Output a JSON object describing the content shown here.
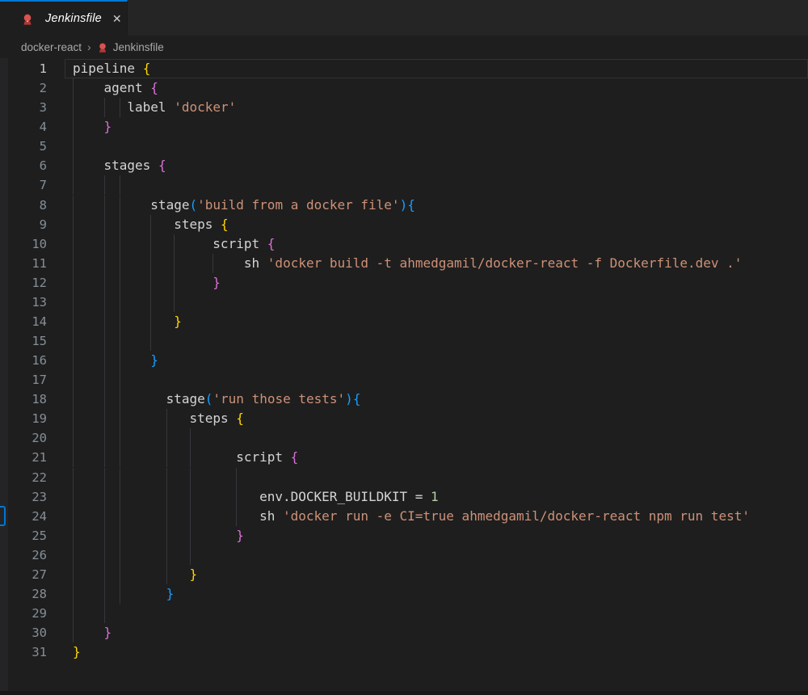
{
  "colors": {
    "bg": "#1e1e1e",
    "panel": "#252526",
    "accent": "#0078d4",
    "crumb": "#a9a9a9",
    "fg": "#d4d4d4",
    "str": "#ce9178",
    "b1": "#ffd700",
    "b2": "#da70d6",
    "b3": "#179fff",
    "num": "#b5cea8",
    "lineNo": "#858f98",
    "lineNoActive": "#c8c8c8",
    "guide": "#37373c",
    "curBorder": "#323232",
    "jenkinsRed": "#d9534f",
    "jenkinsDark": "#7f2a28"
  },
  "tab": {
    "title": "Jenkinsfile",
    "close_label": "✕"
  },
  "breadcrumb": {
    "items": [
      "docker-react",
      "Jenkinsfile"
    ],
    "separator": "›"
  },
  "editor": {
    "current_line": 1,
    "decoration_line": 24,
    "lines": [
      {
        "n": 1,
        "indent": 0,
        "guides": [],
        "spans": [
          [
            "pipeline ",
            "fg"
          ],
          [
            "{",
            "b1"
          ]
        ]
      },
      {
        "n": 2,
        "indent": 4,
        "guides": [
          0
        ],
        "spans": [
          [
            "agent ",
            "fg"
          ],
          [
            "{",
            "b2"
          ]
        ]
      },
      {
        "n": 3,
        "indent": 7,
        "guides": [
          0,
          4,
          6
        ],
        "spans": [
          [
            "label ",
            "fg"
          ],
          [
            "'docker'",
            "str"
          ]
        ]
      },
      {
        "n": 4,
        "indent": 4,
        "guides": [
          0
        ],
        "spans": [
          [
            "}",
            "b2"
          ]
        ]
      },
      {
        "n": 5,
        "indent": 0,
        "guides": [
          0
        ],
        "spans": []
      },
      {
        "n": 6,
        "indent": 4,
        "guides": [
          0
        ],
        "spans": [
          [
            "stages ",
            "fg"
          ],
          [
            "{",
            "b2"
          ]
        ]
      },
      {
        "n": 7,
        "indent": 0,
        "guides": [
          0,
          4,
          6
        ],
        "spans": []
      },
      {
        "n": 8,
        "indent": 10,
        "guides": [
          0,
          4,
          6
        ],
        "spans": [
          [
            "stage",
            "fg"
          ],
          [
            "(",
            "b3"
          ],
          [
            "'build from a docker file'",
            "str"
          ],
          [
            ")",
            "b3"
          ],
          [
            "{",
            "b3"
          ]
        ]
      },
      {
        "n": 9,
        "indent": 13,
        "guides": [
          0,
          4,
          6,
          10
        ],
        "spans": [
          [
            "steps ",
            "fg"
          ],
          [
            "{",
            "b1"
          ]
        ]
      },
      {
        "n": 10,
        "indent": 18,
        "guides": [
          0,
          4,
          6,
          10,
          13
        ],
        "spans": [
          [
            "script ",
            "fg"
          ],
          [
            "{",
            "b2"
          ]
        ]
      },
      {
        "n": 11,
        "indent": 22,
        "guides": [
          0,
          4,
          6,
          10,
          13,
          18
        ],
        "spans": [
          [
            "sh ",
            "fg"
          ],
          [
            "'docker build -t ahmedgamil/docker-react -f Dockerfile.dev .'",
            "str"
          ]
        ]
      },
      {
        "n": 12,
        "indent": 18,
        "guides": [
          0,
          4,
          6,
          10,
          13
        ],
        "spans": [
          [
            "}",
            "b2"
          ]
        ]
      },
      {
        "n": 13,
        "indent": 0,
        "guides": [
          0,
          4,
          6,
          10,
          13
        ],
        "spans": []
      },
      {
        "n": 14,
        "indent": 13,
        "guides": [
          0,
          4,
          6,
          10
        ],
        "spans": [
          [
            "}",
            "b1"
          ]
        ]
      },
      {
        "n": 15,
        "indent": 0,
        "guides": [
          0,
          4,
          6,
          10
        ],
        "spans": []
      },
      {
        "n": 16,
        "indent": 10,
        "guides": [
          0,
          4,
          6
        ],
        "spans": [
          [
            "}",
            "b3"
          ]
        ]
      },
      {
        "n": 17,
        "indent": 0,
        "guides": [
          0,
          4,
          6
        ],
        "spans": []
      },
      {
        "n": 18,
        "indent": 12,
        "guides": [
          0,
          4,
          6
        ],
        "spans": [
          [
            "stage",
            "fg"
          ],
          [
            "(",
            "b3"
          ],
          [
            "'run those tests'",
            "str"
          ],
          [
            ")",
            "b3"
          ],
          [
            "{",
            "b3"
          ]
        ]
      },
      {
        "n": 19,
        "indent": 15,
        "guides": [
          0,
          4,
          6,
          12
        ],
        "spans": [
          [
            "steps ",
            "fg"
          ],
          [
            "{",
            "b1"
          ]
        ]
      },
      {
        "n": 20,
        "indent": 0,
        "guides": [
          0,
          4,
          6,
          12,
          15
        ],
        "spans": []
      },
      {
        "n": 21,
        "indent": 21,
        "guides": [
          0,
          4,
          6,
          12,
          15
        ],
        "spans": [
          [
            "script ",
            "fg"
          ],
          [
            "{",
            "b2"
          ]
        ]
      },
      {
        "n": 22,
        "indent": 0,
        "guides": [
          0,
          4,
          6,
          12,
          15,
          21
        ],
        "spans": []
      },
      {
        "n": 23,
        "indent": 24,
        "guides": [
          0,
          4,
          6,
          12,
          15,
          21
        ],
        "spans": [
          [
            "env.DOCKER_BUILDKIT = ",
            "fg"
          ],
          [
            "1",
            "num"
          ]
        ]
      },
      {
        "n": 24,
        "indent": 24,
        "guides": [
          0,
          4,
          6,
          12,
          15,
          21
        ],
        "spans": [
          [
            "sh ",
            "fg"
          ],
          [
            "'docker run -e CI=true ahmedgamil/docker-react npm run test'",
            "str"
          ]
        ]
      },
      {
        "n": 25,
        "indent": 21,
        "guides": [
          0,
          4,
          6,
          12,
          15
        ],
        "spans": [
          [
            "}",
            "b2"
          ]
        ]
      },
      {
        "n": 26,
        "indent": 0,
        "guides": [
          0,
          4,
          6,
          12,
          15
        ],
        "spans": []
      },
      {
        "n": 27,
        "indent": 15,
        "guides": [
          0,
          4,
          6,
          12
        ],
        "spans": [
          [
            "}",
            "b1"
          ]
        ]
      },
      {
        "n": 28,
        "indent": 12,
        "guides": [
          0,
          4,
          6
        ],
        "spans": [
          [
            "}",
            "b3"
          ]
        ]
      },
      {
        "n": 29,
        "indent": 0,
        "guides": [
          0,
          4
        ],
        "spans": []
      },
      {
        "n": 30,
        "indent": 4,
        "guides": [
          0
        ],
        "spans": [
          [
            "}",
            "b2"
          ]
        ]
      },
      {
        "n": 31,
        "indent": 0,
        "guides": [],
        "spans": [
          [
            "}",
            "b1"
          ]
        ]
      }
    ]
  }
}
